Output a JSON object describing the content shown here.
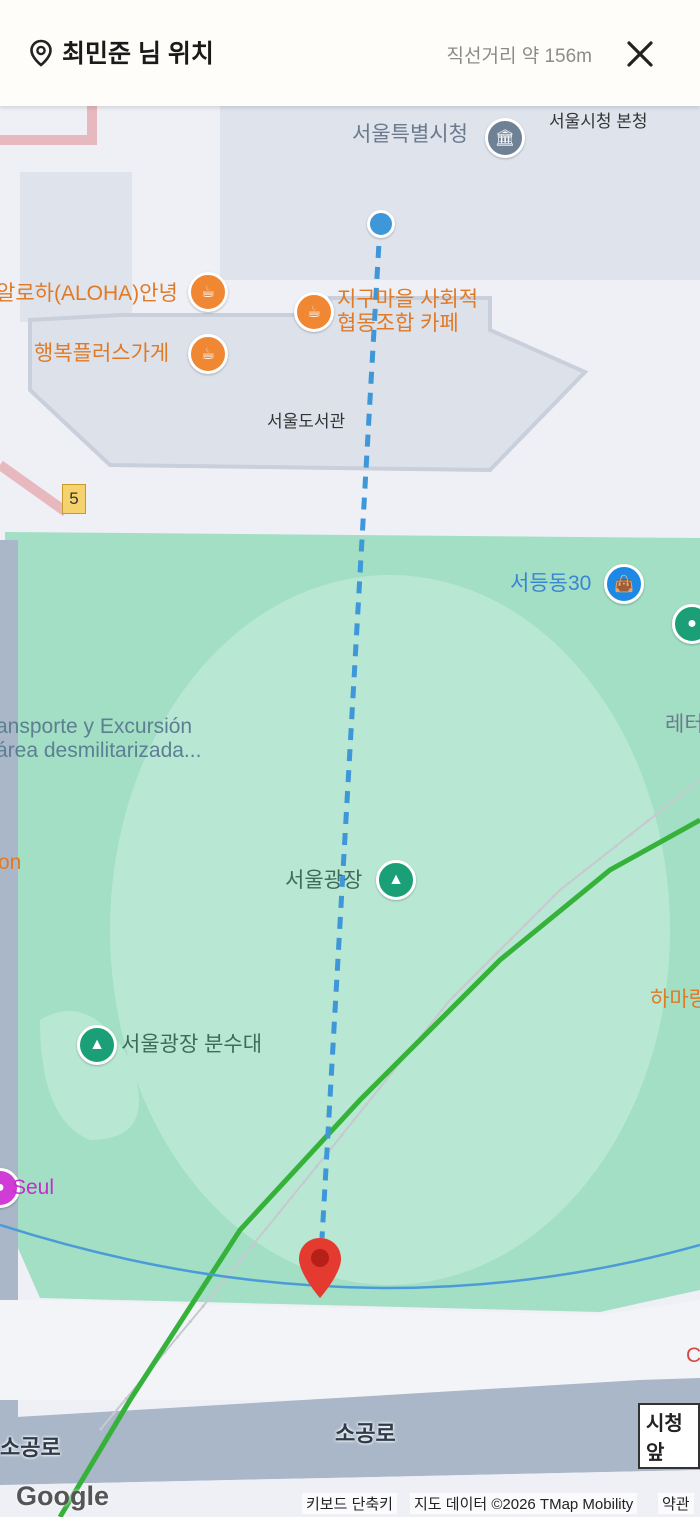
{
  "header": {
    "title": "최민준 님 위치",
    "distance": "직선거리 약 156m",
    "pin_icon": "location-pin-icon",
    "close_icon": "close-icon"
  },
  "map": {
    "labels": {
      "city_hall": "서울특별시청",
      "city_hall_main": "서울시청 본청",
      "aloha": "알로하(ALOHA)안녕",
      "jigu_cafe_line1": "지구마을 사회적",
      "jigu_cafe_line2": "협동조합 카페",
      "happy_plus": "행복플러스가게",
      "library": "서울도서관",
      "seodong": "서등동30",
      "transport_line1": "ansporte y Excursión",
      "transport_line2": "área desmilitarizada...",
      "on": "on",
      "plaza": "서울광장",
      "leto": "레터",
      "fountain": "서울광장 분수대",
      "hama": "하마랑",
      "seul": "Seul",
      "c": "C",
      "sogong_left": "소공로",
      "sogong_center": "소공로",
      "station": "시청앞",
      "route_number": "5"
    },
    "colors": {
      "accent_blue": "#3d97d9",
      "marker_red": "#e43a2f",
      "park_green": "#a2dfc4",
      "subway_green": "#36b13a"
    }
  },
  "footer": {
    "google": "Google",
    "keyboard": "키보드 단축키",
    "map_data": "지도 데이터 ©2026 TMap Mobility",
    "terms": "약관"
  }
}
